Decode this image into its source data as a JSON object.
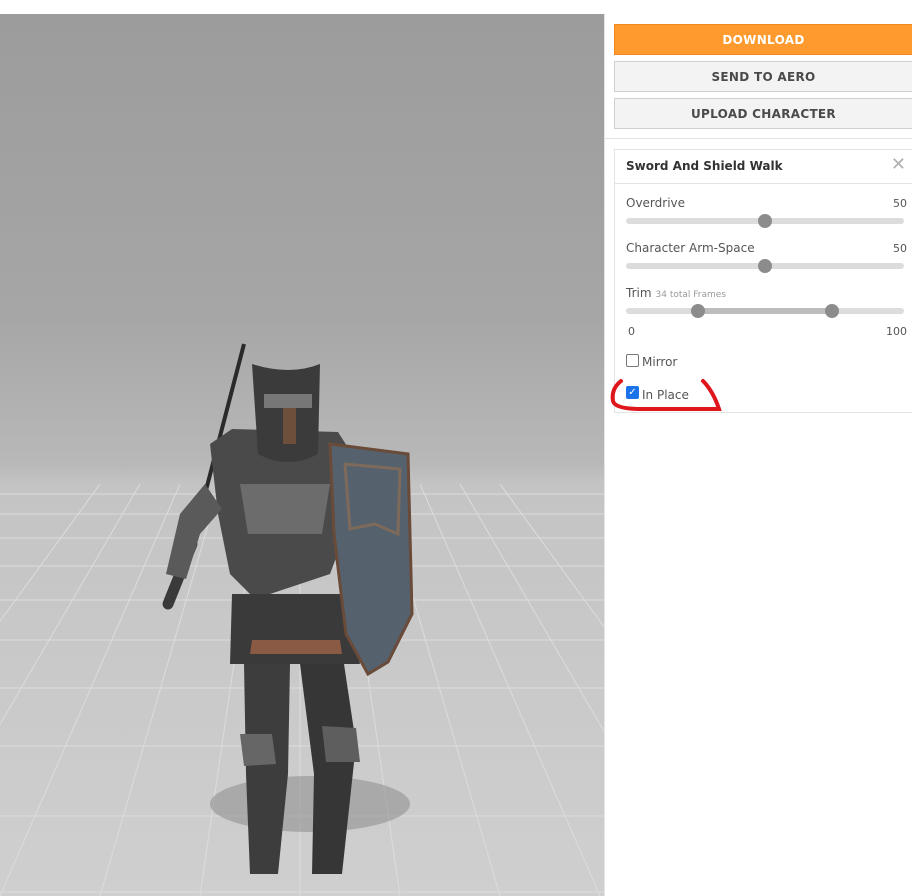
{
  "actions": {
    "download_label": "DOWNLOAD",
    "send_label": "SEND TO AERO",
    "upload_label": "UPLOAD CHARACTER"
  },
  "animation_panel": {
    "title": "Sword And Shield Walk",
    "close_icon": "close-icon",
    "overdrive": {
      "label": "Overdrive",
      "value": "50",
      "fraction": 0.5
    },
    "arm_space": {
      "label": "Character Arm-Space",
      "value": "50",
      "fraction": 0.5
    },
    "trim": {
      "label": "Trim",
      "info": "34 total Frames",
      "min_label": "0",
      "max_label": "100",
      "start_fraction": 0.26,
      "end_fraction": 0.74
    },
    "mirror": {
      "label": "Mirror",
      "checked": false
    },
    "in_place": {
      "label": "In Place",
      "checked": true
    }
  },
  "colors": {
    "accent": "#ff9a2e",
    "highlight_annotation": "#e0161d",
    "checkbox_checked": "#1a73e8"
  }
}
